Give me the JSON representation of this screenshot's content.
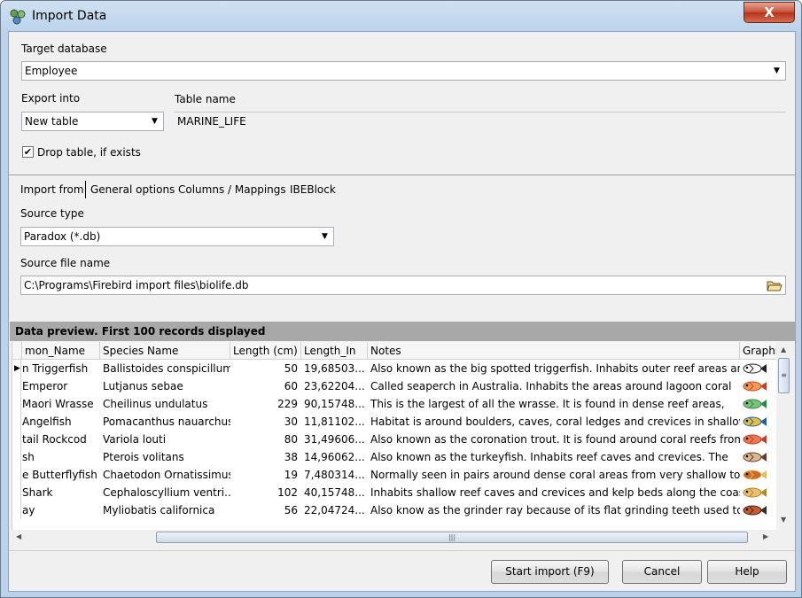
{
  "window": {
    "title": "Import Data",
    "close_symbol": "X"
  },
  "target_database": {
    "label": "Target database",
    "value": "Employee"
  },
  "export_into": {
    "label": "Export into",
    "value": "New table"
  },
  "table_name": {
    "label": "Table name",
    "value": "MARINE_LIFE"
  },
  "drop_table": {
    "label": "Drop table, if exists",
    "checked": true
  },
  "tabs": [
    {
      "label": "Import from"
    },
    {
      "label": "General options"
    },
    {
      "label": "Columns / Mappings"
    },
    {
      "label": "IBEBlock"
    }
  ],
  "source_type": {
    "label": "Source type",
    "value": "Paradox (*.db)"
  },
  "source_file": {
    "label": "Source file name",
    "value": "C:\\Programs\\Firebird import files\\biolife.db"
  },
  "preview": {
    "header": "Data preview. First 100 records displayed",
    "columns": [
      "mon_Name",
      "Species Name",
      "Length (cm)",
      "Length_In",
      "Notes",
      "Graphi"
    ],
    "rows": [
      {
        "common": "n Triggerfish",
        "species": "Ballistoides conspicillum",
        "length_cm": "50",
        "length_in": "19,68503...",
        "notes": "Also known as the big spotted triggerfish.  Inhabits outer reef areas and",
        "current": true
      },
      {
        "common": "Emperor",
        "species": "Lutjanus sebae",
        "length_cm": "60",
        "length_in": "23,62204...",
        "notes": "Called seaperch in Australia.  Inhabits the areas around lagoon coral"
      },
      {
        "common": " Maori Wrasse",
        "species": "Cheilinus undulatus",
        "length_cm": "229",
        "length_in": "90,15748...",
        "notes": "This is the largest of all the wrasse.  It is found in dense reef areas,"
      },
      {
        "common": "Angelfish",
        "species": "Pomacanthus nauarchus",
        "length_cm": "30",
        "length_in": "11,81102...",
        "notes": "Habitat is around boulders, caves, coral ledges and crevices in shallow"
      },
      {
        "common": "tail Rockcod",
        "species": "Variola louti",
        "length_cm": "80",
        "length_in": "31,49606...",
        "notes": "Also known as the coronation trout.  It is found around coral reefs from"
      },
      {
        "common": "sh",
        "species": "Pterois volitans",
        "length_cm": "38",
        "length_in": "14,96062...",
        "notes": "Also known as the turkeyfish.  Inhabits reef caves and crevices.  The"
      },
      {
        "common": "e Butterflyfish",
        "species": "Chaetodon Ornatissimus",
        "length_cm": "19",
        "length_in": "7,480314...",
        "notes": "Normally seen in pairs around dense coral areas from very shallow to"
      },
      {
        "common": " Shark",
        "species": "Cephaloscyllium ventri...",
        "length_cm": "102",
        "length_in": "40,15748...",
        "notes": "Inhabits shallow reef caves and crevices and kelp beds along the coast"
      },
      {
        "common": "ay",
        "species": "Myliobatis californica",
        "length_cm": "56",
        "length_in": "22,04724...",
        "notes": "Also know as the grinder ray because of its flat grinding teeth used to"
      }
    ]
  },
  "buttons": {
    "start": "Start import (F9)",
    "cancel": "Cancel",
    "help": "Help"
  },
  "colors": {
    "titlebar": "#b9d1ea",
    "close": "#c7503a",
    "preview_header": "#a8a8a8",
    "client": "#f0f0f0"
  }
}
